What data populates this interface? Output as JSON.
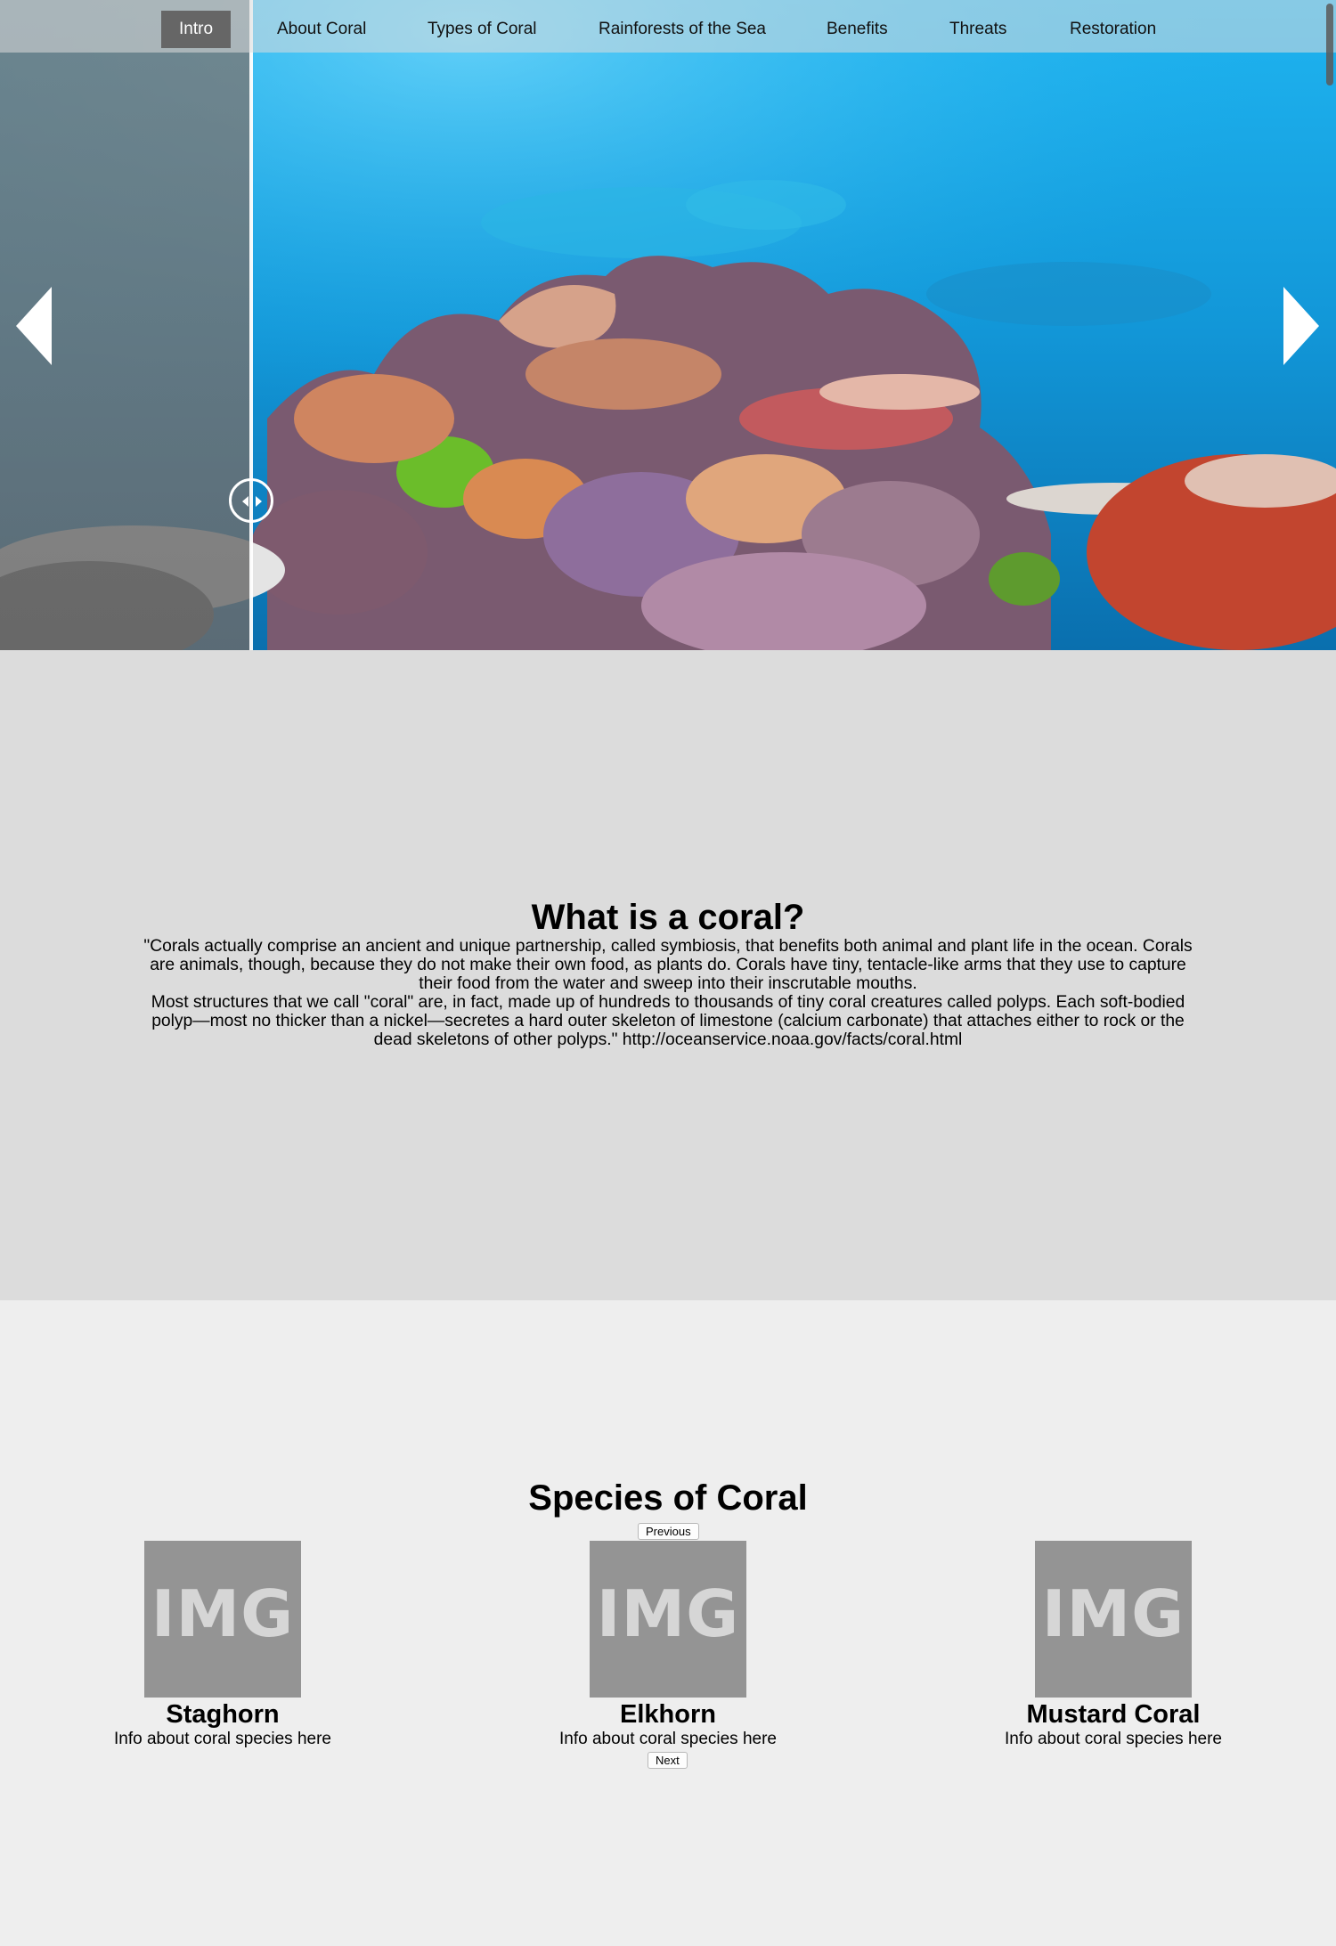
{
  "nav": {
    "items": [
      {
        "label": "Intro",
        "active": true
      },
      {
        "label": "About Coral",
        "active": false
      },
      {
        "label": "Types of Coral",
        "active": false
      },
      {
        "label": "Rainforests of the Sea",
        "active": false
      },
      {
        "label": "Benefits",
        "active": false
      },
      {
        "label": "Threats",
        "active": false
      },
      {
        "label": "Restoration",
        "active": false
      }
    ]
  },
  "hero": {
    "prev_icon": "triangle-left-icon",
    "next_icon": "triangle-right-icon",
    "compare_handle_icon": "compare-slider-icon"
  },
  "about": {
    "title": "What is a coral?",
    "paragraph1": "\"Corals actually comprise an ancient and unique partnership, called symbiosis, that benefits both animal and plant life in the ocean. Corals are animals, though, because they do not make their own food, as plants do. Corals have tiny, tentacle-like arms that they use to capture their food from the water and sweep into their inscrutable mouths.",
    "paragraph2": "Most structures that we call \"coral\" are, in fact, made up of hundreds to thousands of tiny coral creatures called polyps. Each soft-bodied polyp—most no thicker than a nickel—secretes a hard outer skeleton of limestone (calcium carbonate) that attaches either to rock or the dead skeletons of other polyps.\" http://oceanservice.noaa.gov/facts/coral.html"
  },
  "species": {
    "title": "Species of Coral",
    "previous_label": "Previous",
    "next_label": "Next",
    "cards": [
      {
        "img_text": "IMG",
        "name": "Staghorn",
        "info": "Info about coral species here"
      },
      {
        "img_text": "IMG",
        "name": "Elkhorn",
        "info": "Info about coral species here"
      },
      {
        "img_text": "IMG",
        "name": "Mustard Coral",
        "info": "Info about coral species here"
      }
    ]
  },
  "colors": {
    "nav_active_bg": "#666666",
    "section_about_bg": "#dcdcdc",
    "section_species_bg": "#eeeeee",
    "ocean_blue": "#1aa0e0",
    "img_placeholder": "#949494"
  }
}
